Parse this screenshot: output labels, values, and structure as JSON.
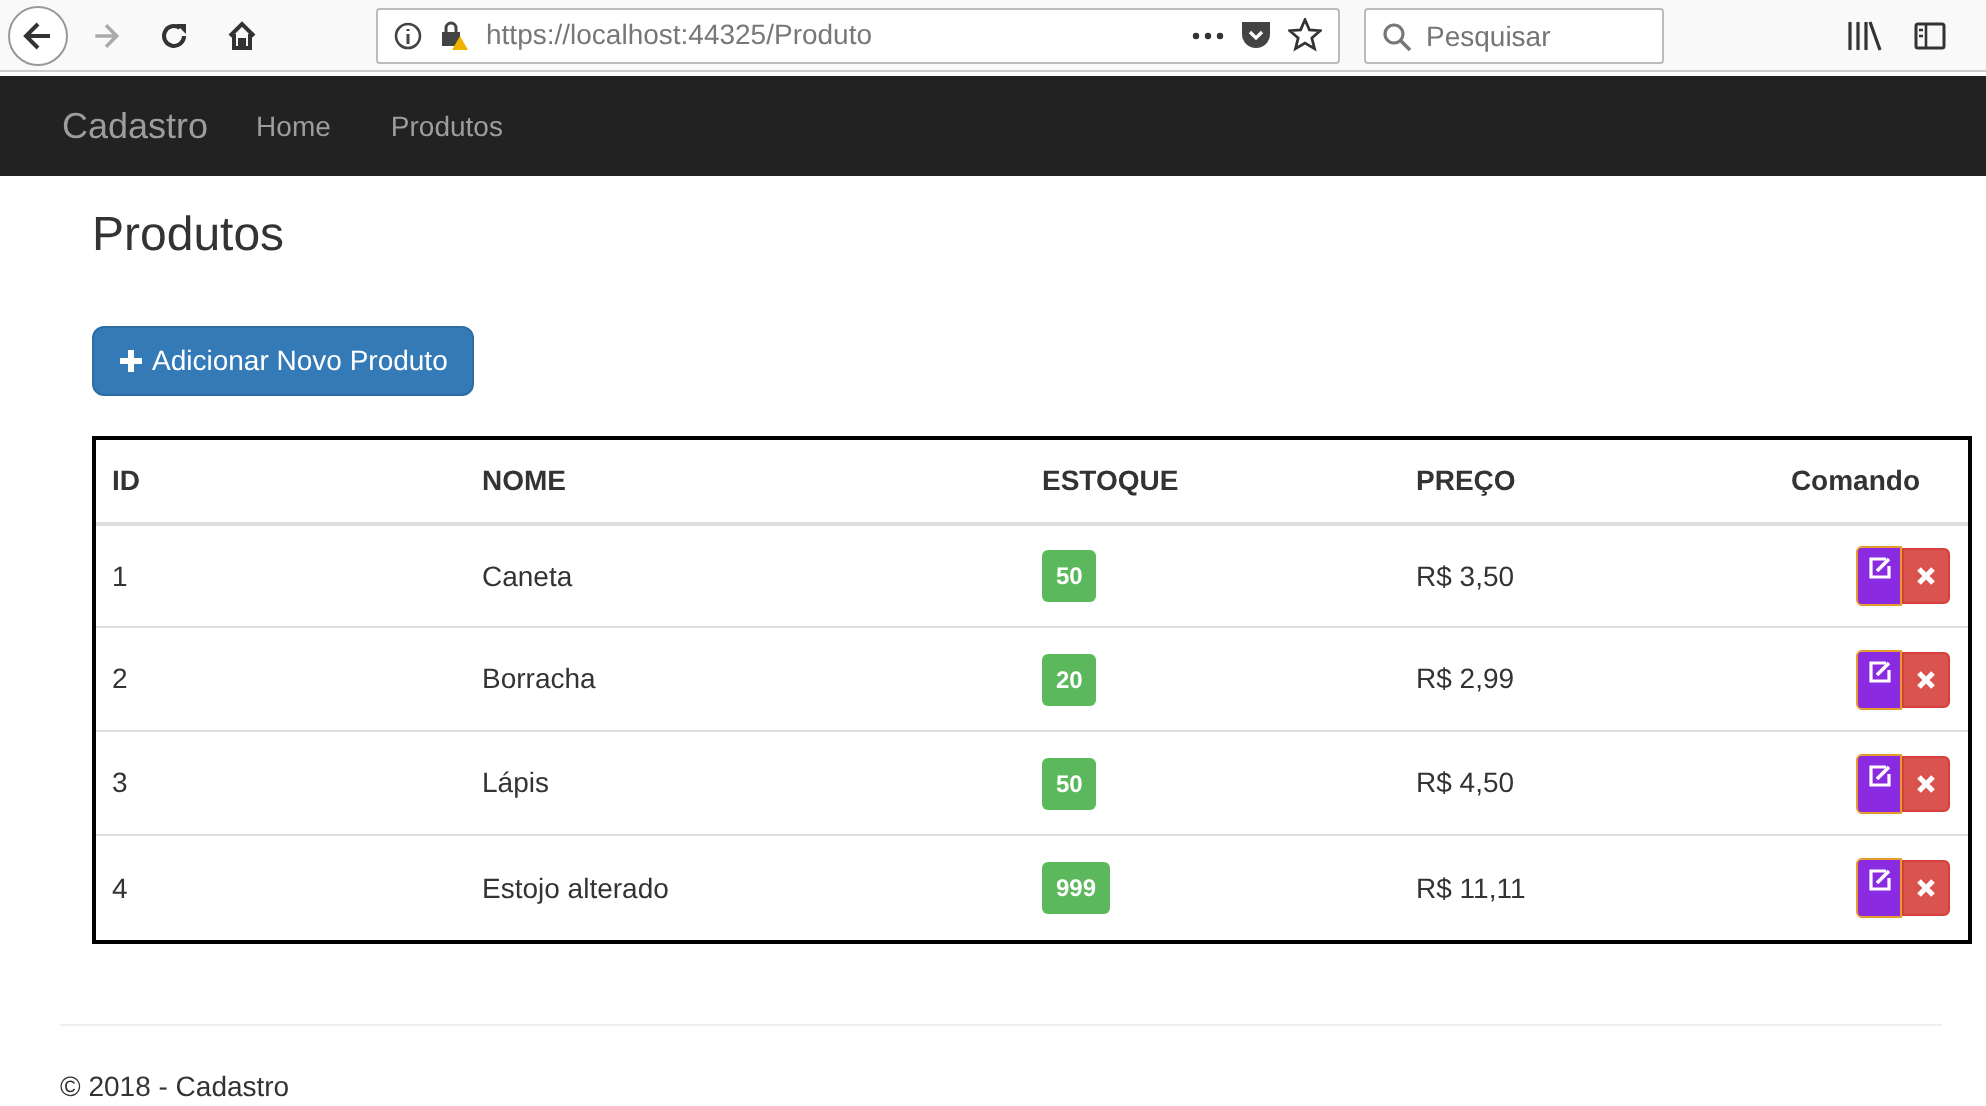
{
  "browser": {
    "url": "https://localhost:44325/Produto",
    "search": {
      "placeholder": "Pesquisar"
    }
  },
  "navbar": {
    "brand": "Cadastro",
    "links": [
      "Home",
      "Produtos"
    ]
  },
  "page_title": "Produtos",
  "add_button": "Adicionar Novo Produto",
  "table": {
    "columns": [
      "ID",
      "NOME",
      "ESTOQUE",
      "PREÇO",
      "Comando"
    ],
    "rows": [
      {
        "id": "1",
        "name": "Caneta",
        "stock": "50",
        "price": "R$ 3,50"
      },
      {
        "id": "2",
        "name": "Borracha",
        "stock": "20",
        "price": "R$ 2,99"
      },
      {
        "id": "3",
        "name": "Lápis",
        "stock": "50",
        "price": "R$ 4,50"
      },
      {
        "id": "4",
        "name": "Estojo alterado",
        "stock": "999",
        "price": "R$ 11,11"
      }
    ]
  },
  "footer": "© 2018 - Cadastro"
}
